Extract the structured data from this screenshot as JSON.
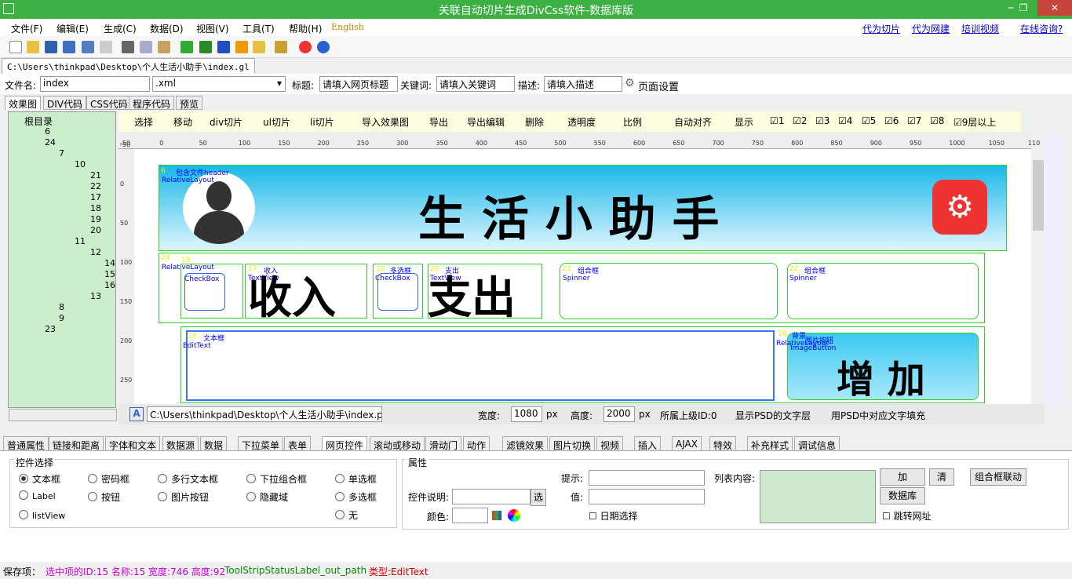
{
  "window": {
    "title": "关联自动切片生成DivCss软件-数据库版"
  },
  "menu": [
    "文件(F)",
    "编辑(E)",
    "生成(C)",
    "数据(D)",
    "视图(V)",
    "工具(T)",
    "帮助(H)"
  ],
  "language": "English",
  "top_links": [
    "代为切片",
    "代为网建",
    "培训视频",
    "在线咨询?"
  ],
  "file_tab": "C:\\Users\\thinkpad\\Desktop\\个人生活小助手\\index.gl",
  "file": {
    "name_label": "文件名:",
    "name_value": "index",
    "ext": ".xml",
    "title_label": "标题:",
    "title_value": "请填入网页标题",
    "keywords_label": "关键词:",
    "keywords_value": "请填入关键词",
    "desc_label": "描述:",
    "desc_value": "请填入描述",
    "page_settings": "页面设置"
  },
  "view_tabs": [
    "效果图",
    "DIV代码",
    "CSS代码",
    "程序代码",
    "预览"
  ],
  "tree": {
    "root": "根目录",
    "nodes": [
      "6",
      "24",
      "7",
      "10",
      "21",
      "22",
      "17",
      "18",
      "19",
      "20",
      "11",
      "12",
      "14",
      "15",
      "16",
      "13",
      "8",
      "9",
      "23"
    ]
  },
  "canvas_tools": [
    "选择",
    "移动",
    "div切片",
    "ul切片",
    "li切片",
    "导入效果图",
    "导出",
    "导出编辑",
    "删除",
    "透明度",
    "比例",
    "自动对齐",
    "显示"
  ],
  "layers": [
    "1",
    "2",
    "3",
    "4",
    "5",
    "6",
    "7",
    "8",
    "9层以上"
  ],
  "ruler_x": [
    "-50",
    "0",
    "50",
    "100",
    "150",
    "200",
    "250",
    "300",
    "350",
    "400",
    "450",
    "500",
    "550",
    "600",
    "650",
    "700",
    "750",
    "800",
    "850",
    "900",
    "950",
    "1000",
    "1050",
    "110"
  ],
  "ruler_y": [
    "-50",
    "0",
    "50",
    "100",
    "150",
    "200",
    "250"
  ],
  "design": {
    "header_title": "生 活 小 助 手",
    "income": "收入",
    "expense": "支出",
    "add": "增 加",
    "labels": {
      "header": "包含文件header",
      "relative": "RelativeLayout",
      "checkbox": "CheckBox",
      "multi": "多选框",
      "textview": "TextView",
      "combo": "组合框",
      "spinner": "Spinner",
      "text": "文本框",
      "edittext": "EditText",
      "imgbtn": "图片按钮",
      "imagebutton": "ImageButton",
      "bg": "背景",
      "income_small": "收入",
      "expense_small": "支出"
    },
    "ids": {
      "n6": "6",
      "n24": "24",
      "n19": "19",
      "n17": "17",
      "n10": "10",
      "n20": "20",
      "n21": "21",
      "n22": "22",
      "n15": "15",
      "n16": "16"
    }
  },
  "path_bar": {
    "path": "C:\\Users\\thinkpad\\Desktop\\个人生活小助手\\index.p",
    "width_label": "宽度:",
    "width_value": "1080",
    "px": "px",
    "height_label": "高度:",
    "height_value": "2000",
    "parent": "所属上级ID:0",
    "psd_text": "显示PSD的文字层",
    "fill_text": "用PSD中对应文字填充"
  },
  "bottom_tabs": [
    "普通属性",
    "链接和距离",
    "字体和文本",
    "数据源",
    "数据",
    "下拉菜单",
    "表单",
    "网页控件",
    "滚动或移动",
    "滑动门",
    "动作",
    "滤镜效果",
    "图片切换",
    "视频",
    "插入",
    "AJAX",
    "特效",
    "补充样式",
    "调试信息"
  ],
  "controls": {
    "title": "控件选择",
    "items": [
      "文本框",
      "密码框",
      "多行文本框",
      "下拉组合框",
      "单选框",
      "Label",
      "按钮",
      "图片按钮",
      "隐藏域",
      "多选框",
      "listView",
      "无"
    ],
    "selected": "文本框"
  },
  "props": {
    "title": "属性",
    "hint": "提示:",
    "value": "值:",
    "desc": "控件说明:",
    "pick": "选",
    "color": "颜色:",
    "date": "日期选择",
    "list": "列表内容:",
    "add": "加",
    "clear": "清",
    "combo_link": "组合框联动",
    "db": "数据库",
    "jump": "跳转网址"
  },
  "status": {
    "save": "保存项：",
    "selected": "选中项的ID:15 名称:15 宽度:746 高度:92",
    "path": "ToolStripStatusLabel_out_path",
    "type": "类型:EditText"
  }
}
